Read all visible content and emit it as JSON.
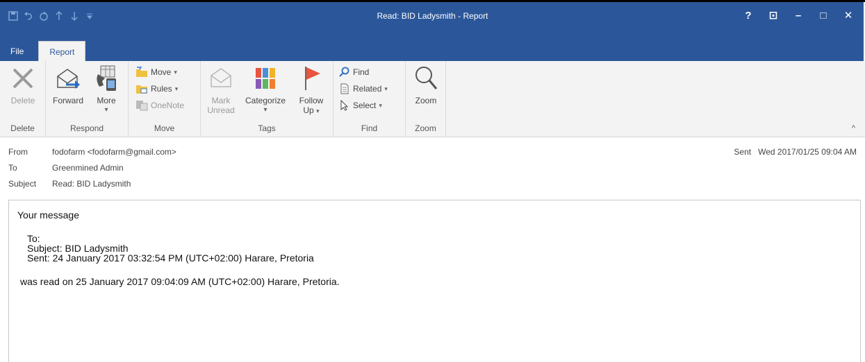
{
  "window": {
    "title": "Read: BID Ladysmith - Report",
    "qat_icons": [
      "save-icon",
      "undo-icon",
      "redo-icon",
      "up-icon",
      "down-icon",
      "customize-icon"
    ],
    "controls": [
      "?",
      "⊡",
      "–",
      "□",
      "✕"
    ]
  },
  "tabs": [
    {
      "label": "File"
    },
    {
      "label": "Report"
    }
  ],
  "ribbon": {
    "delete": {
      "button": "Delete",
      "group": "Delete"
    },
    "respond": {
      "forward": "Forward",
      "more": "More",
      "more_arrow": "▾",
      "group": "Respond"
    },
    "move": {
      "move": "Move",
      "rules": "Rules",
      "onenote": "OneNote",
      "group": "Move"
    },
    "tags": {
      "mark_unread_1": "Mark",
      "mark_unread_2": "Unread",
      "categorize": "Categorize",
      "categorize_arrow": "▾",
      "follow_up_1": "Follow",
      "follow_up_2": "Up",
      "group": "Tags"
    },
    "find": {
      "find": "Find",
      "related": "Related",
      "select": "Select",
      "group": "Find"
    },
    "zoom": {
      "zoom": "Zoom",
      "group": "Zoom"
    },
    "dropdown_arrow": "▾",
    "collapse": "^"
  },
  "headers": {
    "from_label": "From",
    "from_value": "fodofarm <fodofarm@gmail.com>",
    "to_label": "To",
    "to_value": "Greenmined Admin",
    "subject_label": "Subject",
    "subject_value": "Read: BID Ladysmith",
    "sent_label": "Sent",
    "sent_value": "Wed 2017/01/25 09:04 AM"
  },
  "message": {
    "line1": "Your message",
    "line2": "To:",
    "line3": "Subject: BID Ladysmith",
    "line4": "Sent: 24 January 2017 03:32:54 PM (UTC+02:00) Harare, Pretoria",
    "line5": "was read on 25 January 2017 09:04:09 AM (UTC+02:00) Harare, Pretoria."
  },
  "colors": {
    "title_bar": "#2b579a",
    "ribbon": "#f3f3f3",
    "flag": "#e8553f"
  }
}
